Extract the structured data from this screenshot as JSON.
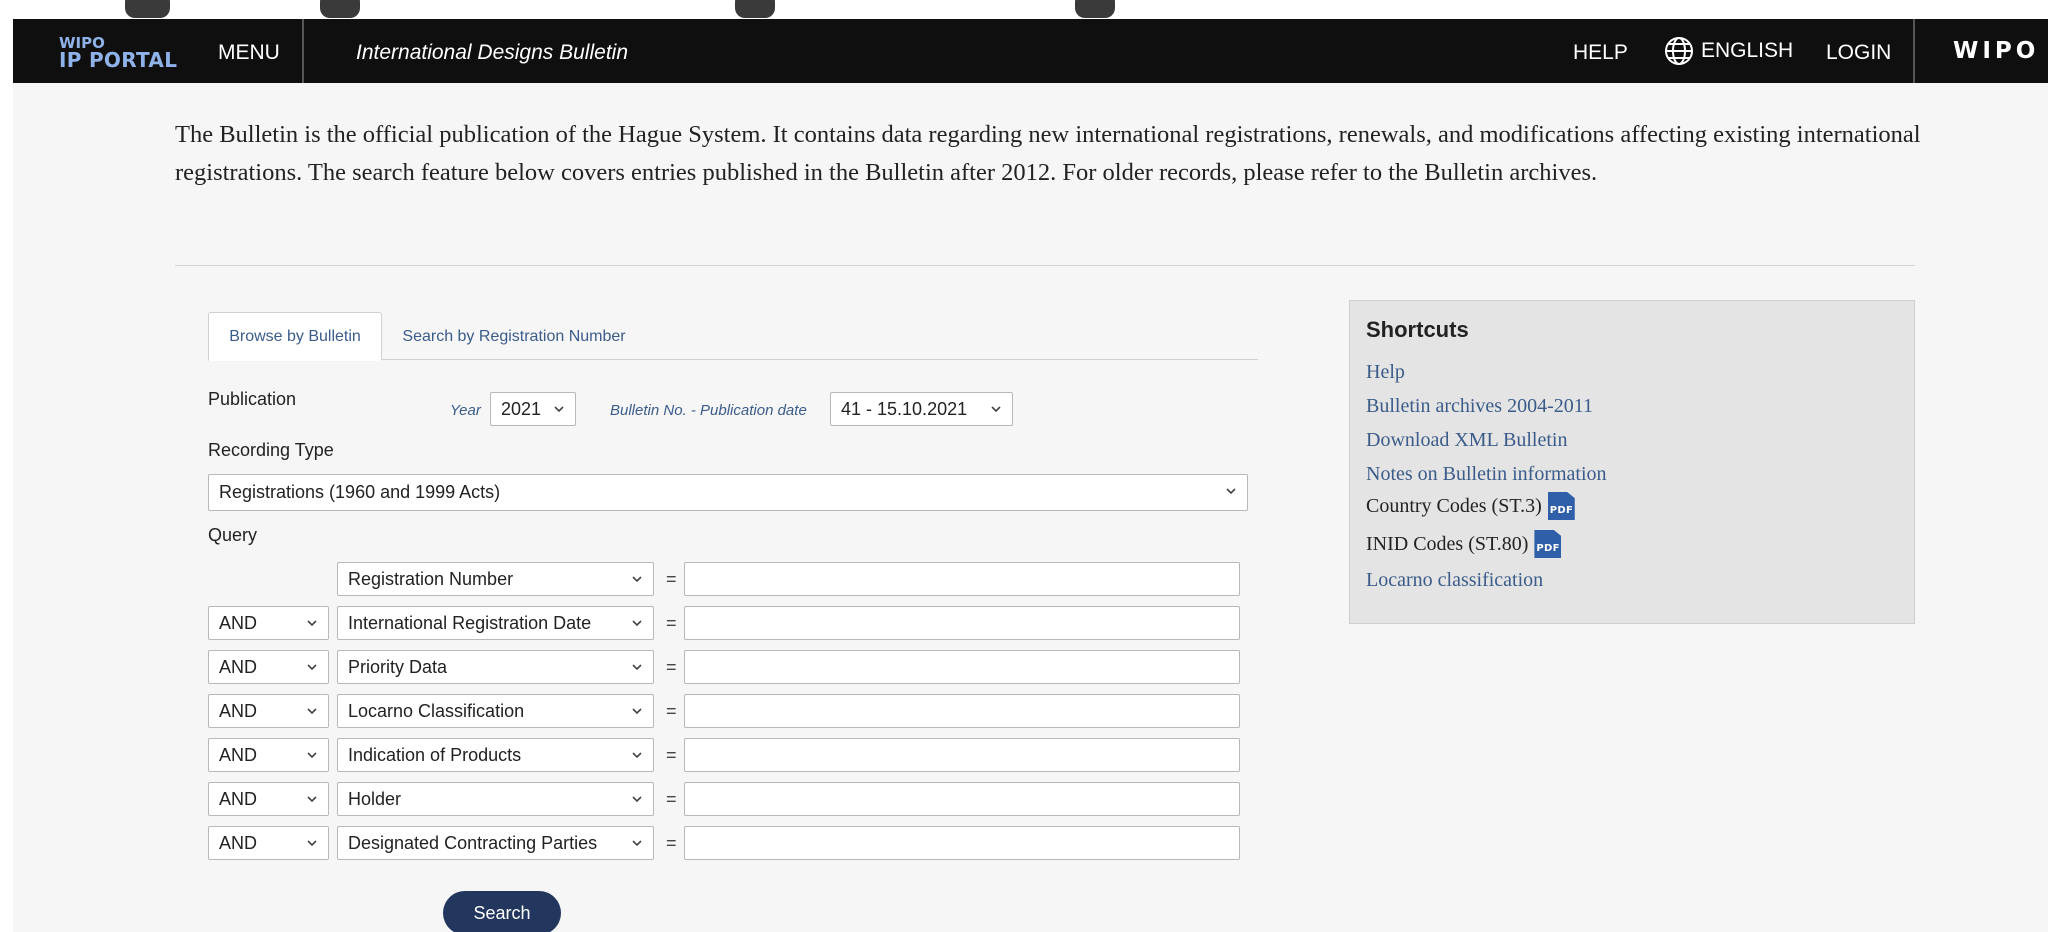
{
  "header": {
    "logo_line1": "WIPO",
    "logo_line2": "IP PORTAL",
    "menu": "MENU",
    "app_title": "International Designs Bulletin",
    "help": "HELP",
    "language": "ENGLISH",
    "login": "LOGIN",
    "brand": "WIPO"
  },
  "intro": "The Bulletin is the official publication of the Hague System. It contains data regarding new international registrations, renewals, and modifications affecting existing international registrations. The search feature below covers entries published in the Bulletin after 2012. For older records, please refer to the Bulletin archives.",
  "tabs": [
    "Browse by Bulletin",
    "Search by Registration Number"
  ],
  "form": {
    "publication_label": "Publication",
    "year_label": "Year",
    "year_value": "2021",
    "bulletin_label": "Bulletin No. - Publication date",
    "bulletin_value": "41 - 15.10.2021",
    "recording_type_label": "Recording Type",
    "recording_type_value": "Registrations (1960 and 1999 Acts)",
    "query_label": "Query",
    "equals": "=",
    "query_rows": [
      {
        "operator": "",
        "field": "Registration Number",
        "value": ""
      },
      {
        "operator": "AND",
        "field": "International Registration Date",
        "value": ""
      },
      {
        "operator": "AND",
        "field": "Priority Data",
        "value": ""
      },
      {
        "operator": "AND",
        "field": "Locarno Classification",
        "value": ""
      },
      {
        "operator": "AND",
        "field": "Indication of Products",
        "value": ""
      },
      {
        "operator": "AND",
        "field": "Holder",
        "value": ""
      },
      {
        "operator": "AND",
        "field": "Designated Contracting Parties",
        "value": ""
      }
    ],
    "search_button": "Search"
  },
  "shortcuts": {
    "title": "Shortcuts",
    "links": [
      "Help",
      "Bulletin archives 2004-2011",
      "Download XML Bulletin",
      "Notes on Bulletin information",
      "Country Codes (ST.3)",
      "INID Codes (ST.80)",
      "Locarno classification"
    ],
    "pdf_badge": "PDF"
  },
  "colors": {
    "header_bg": "#0f0f0f",
    "logo": "#8fb3e8",
    "link": "#3b5c8a",
    "button": "#23375e",
    "pdf_icon": "#2f5fa8"
  }
}
